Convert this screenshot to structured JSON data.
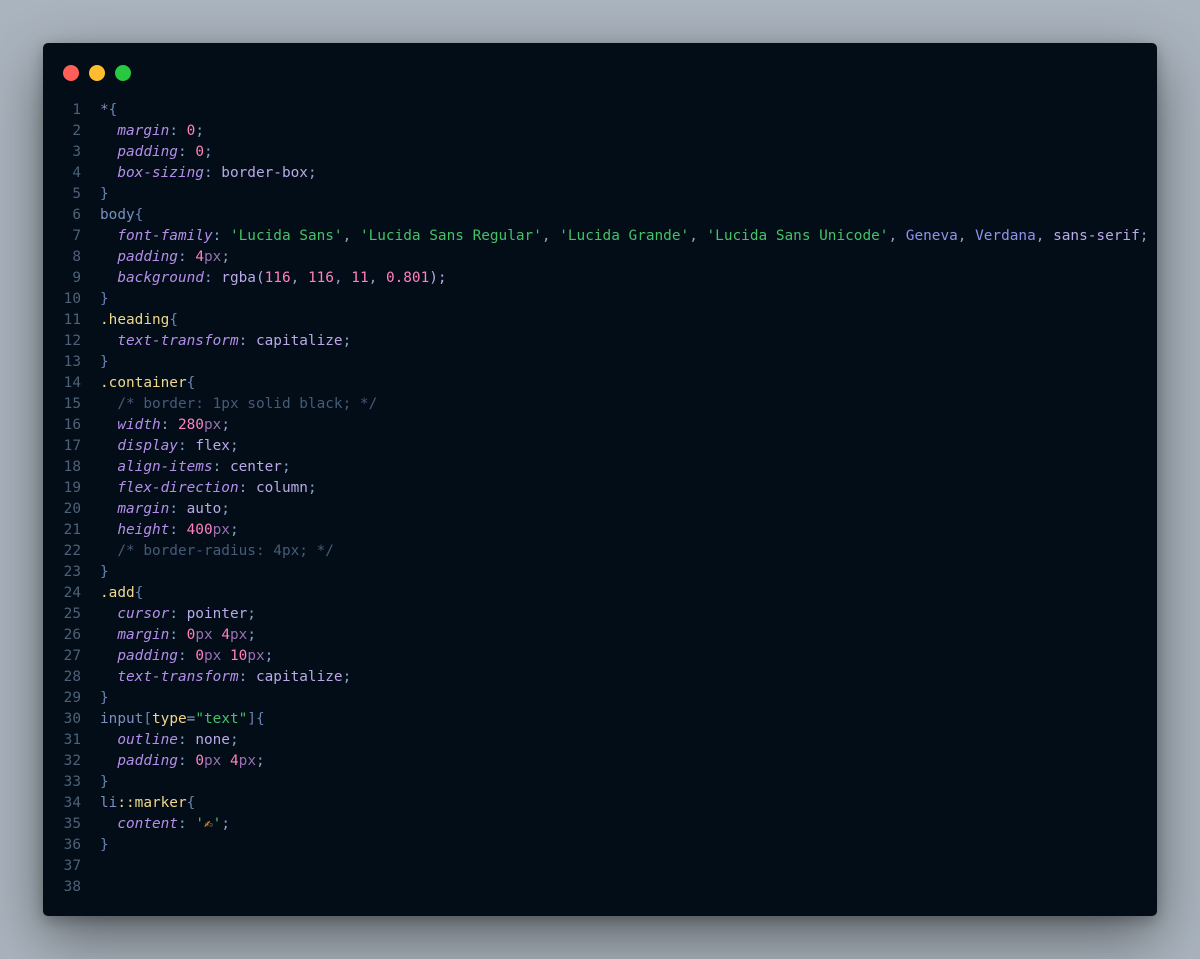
{
  "window": {
    "controls": [
      {
        "name": "close",
        "color": "#ff5f57"
      },
      {
        "name": "minimize",
        "color": "#febc2e"
      },
      {
        "name": "zoom",
        "color": "#28c840"
      }
    ]
  },
  "colors": {
    "selector": "#7b8fbf",
    "class_selector": "#f0d78c",
    "brace": "#6a83b4",
    "property": "#b48ee8",
    "punct": "#8aa2c8",
    "value": "#b9a9e6",
    "number": "#ff80bf",
    "unit": "#9a6fb3",
    "string": "#45c267",
    "comment": "#475a78",
    "attr": "#f0d78c",
    "ident": "#8f93ec",
    "emoji": "#f1a93a"
  },
  "code_lines": [
    [
      {
        "t": "*",
        "c": "selector"
      },
      {
        "t": "{",
        "c": "brace"
      }
    ],
    [
      {
        "t": "  "
      },
      {
        "t": "margin",
        "c": "property",
        "i": true
      },
      {
        "t": ": ",
        "c": "punct"
      },
      {
        "t": "0",
        "c": "number"
      },
      {
        "t": ";",
        "c": "punct"
      }
    ],
    [
      {
        "t": "  "
      },
      {
        "t": "padding",
        "c": "property",
        "i": true
      },
      {
        "t": ": ",
        "c": "punct"
      },
      {
        "t": "0",
        "c": "number"
      },
      {
        "t": ";",
        "c": "punct"
      }
    ],
    [
      {
        "t": "  "
      },
      {
        "t": "box-sizing",
        "c": "property",
        "i": true
      },
      {
        "t": ": ",
        "c": "punct"
      },
      {
        "t": "border-box",
        "c": "value"
      },
      {
        "t": ";",
        "c": "punct"
      }
    ],
    [
      {
        "t": "}",
        "c": "brace"
      }
    ],
    [
      {
        "t": "body",
        "c": "selector"
      },
      {
        "t": "{",
        "c": "brace"
      }
    ],
    [
      {
        "t": "  "
      },
      {
        "t": "font-family",
        "c": "property",
        "i": true
      },
      {
        "t": ": ",
        "c": "punct"
      },
      {
        "t": "'Lucida Sans'",
        "c": "string"
      },
      {
        "t": ", ",
        "c": "punct"
      },
      {
        "t": "'Lucida Sans Regular'",
        "c": "string"
      },
      {
        "t": ", ",
        "c": "punct"
      },
      {
        "t": "'Lucida Grande'",
        "c": "string"
      },
      {
        "t": ", ",
        "c": "punct"
      },
      {
        "t": "'Lucida Sans Unicode'",
        "c": "string"
      },
      {
        "t": ", ",
        "c": "punct"
      },
      {
        "t": "Geneva",
        "c": "ident"
      },
      {
        "t": ", ",
        "c": "punct"
      },
      {
        "t": "Verdana",
        "c": "ident"
      },
      {
        "t": ", ",
        "c": "punct"
      },
      {
        "t": "sans-serif",
        "c": "value"
      },
      {
        "t": ";",
        "c": "punct"
      }
    ],
    [
      {
        "t": "  "
      },
      {
        "t": "padding",
        "c": "property",
        "i": true
      },
      {
        "t": ": ",
        "c": "punct"
      },
      {
        "t": "4",
        "c": "number"
      },
      {
        "t": "px",
        "c": "unit"
      },
      {
        "t": ";",
        "c": "punct"
      }
    ],
    [
      {
        "t": "  "
      },
      {
        "t": "background",
        "c": "property",
        "i": true
      },
      {
        "t": ": ",
        "c": "punct"
      },
      {
        "t": "rgba(",
        "c": "value"
      },
      {
        "t": "116",
        "c": "number"
      },
      {
        "t": ", ",
        "c": "punct"
      },
      {
        "t": "116",
        "c": "number"
      },
      {
        "t": ", ",
        "c": "punct"
      },
      {
        "t": "11",
        "c": "number"
      },
      {
        "t": ", ",
        "c": "punct"
      },
      {
        "t": "0.801",
        "c": "number"
      },
      {
        "t": ");",
        "c": "value"
      }
    ],
    [
      {
        "t": "}",
        "c": "brace"
      }
    ],
    [
      {
        "t": ".heading",
        "c": "class_selector"
      },
      {
        "t": "{",
        "c": "brace"
      }
    ],
    [
      {
        "t": "  "
      },
      {
        "t": "text-transform",
        "c": "property",
        "i": true
      },
      {
        "t": ": ",
        "c": "punct"
      },
      {
        "t": "capitalize",
        "c": "value"
      },
      {
        "t": ";",
        "c": "punct"
      }
    ],
    [
      {
        "t": "}",
        "c": "brace"
      }
    ],
    [
      {
        "t": ".container",
        "c": "class_selector"
      },
      {
        "t": "{",
        "c": "brace"
      }
    ],
    [
      {
        "t": "  "
      },
      {
        "t": "/* border: 1px solid black; */",
        "c": "comment"
      }
    ],
    [
      {
        "t": "  "
      },
      {
        "t": "width",
        "c": "property",
        "i": true
      },
      {
        "t": ": ",
        "c": "punct"
      },
      {
        "t": "280",
        "c": "number"
      },
      {
        "t": "px",
        "c": "unit"
      },
      {
        "t": ";",
        "c": "punct"
      }
    ],
    [
      {
        "t": "  "
      },
      {
        "t": "display",
        "c": "property",
        "i": true
      },
      {
        "t": ": ",
        "c": "punct"
      },
      {
        "t": "flex",
        "c": "value"
      },
      {
        "t": ";",
        "c": "punct"
      }
    ],
    [
      {
        "t": "  "
      },
      {
        "t": "align-items",
        "c": "property",
        "i": true
      },
      {
        "t": ": ",
        "c": "punct"
      },
      {
        "t": "center",
        "c": "value"
      },
      {
        "t": ";",
        "c": "punct"
      }
    ],
    [
      {
        "t": "  "
      },
      {
        "t": "flex-direction",
        "c": "property",
        "i": true
      },
      {
        "t": ": ",
        "c": "punct"
      },
      {
        "t": "column",
        "c": "value"
      },
      {
        "t": ";",
        "c": "punct"
      }
    ],
    [
      {
        "t": "  "
      },
      {
        "t": "margin",
        "c": "property",
        "i": true
      },
      {
        "t": ": ",
        "c": "punct"
      },
      {
        "t": "auto",
        "c": "value"
      },
      {
        "t": ";",
        "c": "punct"
      }
    ],
    [
      {
        "t": "  "
      },
      {
        "t": "height",
        "c": "property",
        "i": true
      },
      {
        "t": ": ",
        "c": "punct"
      },
      {
        "t": "400",
        "c": "number"
      },
      {
        "t": "px",
        "c": "unit"
      },
      {
        "t": ";",
        "c": "punct"
      }
    ],
    [
      {
        "t": "  "
      },
      {
        "t": "/* border-radius: 4px; */",
        "c": "comment"
      }
    ],
    [
      {
        "t": "}",
        "c": "brace"
      }
    ],
    [
      {
        "t": ".add",
        "c": "class_selector"
      },
      {
        "t": "{",
        "c": "brace"
      }
    ],
    [
      {
        "t": "  "
      },
      {
        "t": "cursor",
        "c": "property",
        "i": true
      },
      {
        "t": ": ",
        "c": "punct"
      },
      {
        "t": "pointer",
        "c": "value"
      },
      {
        "t": ";",
        "c": "punct"
      }
    ],
    [
      {
        "t": "  "
      },
      {
        "t": "margin",
        "c": "property",
        "i": true
      },
      {
        "t": ": ",
        "c": "punct"
      },
      {
        "t": "0",
        "c": "number"
      },
      {
        "t": "px",
        "c": "unit"
      },
      {
        "t": " "
      },
      {
        "t": "4",
        "c": "number"
      },
      {
        "t": "px",
        "c": "unit"
      },
      {
        "t": ";",
        "c": "punct"
      }
    ],
    [
      {
        "t": "  "
      },
      {
        "t": "padding",
        "c": "property",
        "i": true
      },
      {
        "t": ": ",
        "c": "punct"
      },
      {
        "t": "0",
        "c": "number"
      },
      {
        "t": "px",
        "c": "unit"
      },
      {
        "t": " "
      },
      {
        "t": "10",
        "c": "number"
      },
      {
        "t": "px",
        "c": "unit"
      },
      {
        "t": ";",
        "c": "punct"
      }
    ],
    [
      {
        "t": "  "
      },
      {
        "t": "text-transform",
        "c": "property",
        "i": true
      },
      {
        "t": ": ",
        "c": "punct"
      },
      {
        "t": "capitalize",
        "c": "value"
      },
      {
        "t": ";",
        "c": "punct"
      }
    ],
    [
      {
        "t": "}",
        "c": "brace"
      }
    ],
    [
      {
        "t": "input",
        "c": "selector"
      },
      {
        "t": "[",
        "c": "brace"
      },
      {
        "t": "type",
        "c": "attr"
      },
      {
        "t": "=",
        "c": "punct"
      },
      {
        "t": "\"text\"",
        "c": "string"
      },
      {
        "t": "]",
        "c": "brace"
      },
      {
        "t": "{",
        "c": "brace"
      }
    ],
    [
      {
        "t": "  "
      },
      {
        "t": "outline",
        "c": "property",
        "i": true
      },
      {
        "t": ": ",
        "c": "punct"
      },
      {
        "t": "none",
        "c": "value"
      },
      {
        "t": ";",
        "c": "punct"
      }
    ],
    [
      {
        "t": "  "
      },
      {
        "t": "padding",
        "c": "property",
        "i": true
      },
      {
        "t": ": ",
        "c": "punct"
      },
      {
        "t": "0",
        "c": "number"
      },
      {
        "t": "px",
        "c": "unit"
      },
      {
        "t": " "
      },
      {
        "t": "4",
        "c": "number"
      },
      {
        "t": "px",
        "c": "unit"
      },
      {
        "t": ";",
        "c": "punct"
      }
    ],
    [
      {
        "t": "}",
        "c": "brace"
      }
    ],
    [
      {
        "t": "li",
        "c": "selector"
      },
      {
        "t": "::marker",
        "c": "class_selector"
      },
      {
        "t": "{",
        "c": "brace"
      }
    ],
    [
      {
        "t": "  "
      },
      {
        "t": "content",
        "c": "property",
        "i": true
      },
      {
        "t": ": ",
        "c": "punct"
      },
      {
        "t": "'",
        "c": "string"
      },
      {
        "t": "✍",
        "c": "emoji"
      },
      {
        "t": "'",
        "c": "string"
      },
      {
        "t": ";",
        "c": "punct"
      }
    ],
    [
      {
        "t": "}",
        "c": "brace"
      }
    ],
    [],
    []
  ]
}
